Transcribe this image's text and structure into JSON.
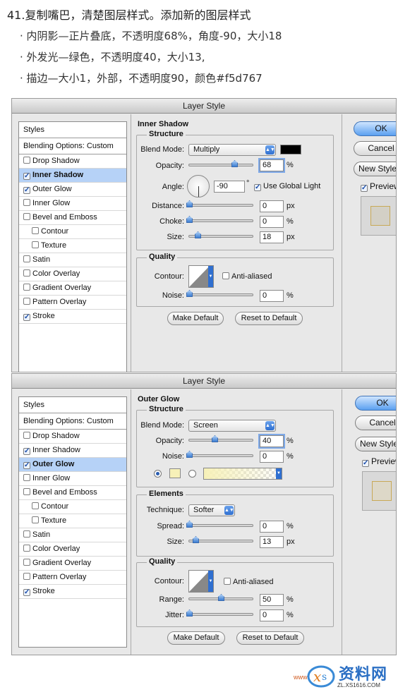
{
  "instructions": {
    "step": "41.复制嘴巴，清楚图层样式。添加新的图层样式",
    "b1": "· 内阴影—正片叠底，不透明度68%，角度-90，大小18",
    "b2": "· 外发光—绿色，不透明度40，大小13,",
    "b3": "· 描边—大小1，外部，不透明度90，颜色#f5d767"
  },
  "dialog1": {
    "title": "Layer Style",
    "styles": [
      {
        "label": "Styles",
        "checkbox": false
      },
      {
        "label": "Blending Options: Custom",
        "checkbox": false
      },
      {
        "label": "Drop Shadow",
        "checkbox": true,
        "checked": false
      },
      {
        "label": "Inner Shadow",
        "checkbox": true,
        "checked": true,
        "selected": true
      },
      {
        "label": "Outer Glow",
        "checkbox": true,
        "checked": true
      },
      {
        "label": "Inner Glow",
        "checkbox": true,
        "checked": false
      },
      {
        "label": "Bevel and Emboss",
        "checkbox": true,
        "checked": false
      },
      {
        "label": "Contour",
        "checkbox": true,
        "checked": false,
        "indent": true
      },
      {
        "label": "Texture",
        "checkbox": true,
        "checked": false,
        "indent": true
      },
      {
        "label": "Satin",
        "checkbox": true,
        "checked": false
      },
      {
        "label": "Color Overlay",
        "checkbox": true,
        "checked": false
      },
      {
        "label": "Gradient Overlay",
        "checkbox": true,
        "checked": false
      },
      {
        "label": "Pattern Overlay",
        "checkbox": true,
        "checked": false
      },
      {
        "label": "Stroke",
        "checkbox": true,
        "checked": true
      }
    ],
    "section": "Inner Shadow",
    "structure": "Structure",
    "blend_mode_label": "Blend Mode:",
    "blend_mode": "Multiply",
    "blend_color": "#000000",
    "opacity_label": "Opacity:",
    "opacity": "68",
    "angle_label": "Angle:",
    "angle": "-90",
    "global_light": "Use Global Light",
    "distance_label": "Distance:",
    "distance": "0",
    "choke_label": "Choke:",
    "choke": "0",
    "size_label": "Size:",
    "size": "18",
    "quality": "Quality",
    "contour_label": "Contour:",
    "anti_aliased": "Anti-aliased",
    "noise_label": "Noise:",
    "noise": "0",
    "make_default": "Make Default",
    "reset_default": "Reset to Default",
    "ok": "OK",
    "cancel": "Cancel",
    "new_style": "New Style...",
    "preview": "Preview",
    "unit_pct": "%",
    "unit_px": "px",
    "deg": "°"
  },
  "dialog2": {
    "title": "Layer Style",
    "styles": [
      {
        "label": "Styles",
        "checkbox": false
      },
      {
        "label": "Blending Options: Custom",
        "checkbox": false
      },
      {
        "label": "Drop Shadow",
        "checkbox": true,
        "checked": false
      },
      {
        "label": "Inner Shadow",
        "checkbox": true,
        "checked": true
      },
      {
        "label": "Outer Glow",
        "checkbox": true,
        "checked": true,
        "selected": true
      },
      {
        "label": "Inner Glow",
        "checkbox": true,
        "checked": false
      },
      {
        "label": "Bevel and Emboss",
        "checkbox": true,
        "checked": false
      },
      {
        "label": "Contour",
        "checkbox": true,
        "checked": false,
        "indent": true
      },
      {
        "label": "Texture",
        "checkbox": true,
        "checked": false,
        "indent": true
      },
      {
        "label": "Satin",
        "checkbox": true,
        "checked": false
      },
      {
        "label": "Color Overlay",
        "checkbox": true,
        "checked": false
      },
      {
        "label": "Gradient Overlay",
        "checkbox": true,
        "checked": false
      },
      {
        "label": "Pattern Overlay",
        "checkbox": true,
        "checked": false
      },
      {
        "label": "Stroke",
        "checkbox": true,
        "checked": true
      }
    ],
    "section": "Outer Glow",
    "structure": "Structure",
    "blend_mode_label": "Blend Mode:",
    "blend_mode": "Screen",
    "opacity_label": "Opacity:",
    "opacity": "40",
    "noise_label": "Noise:",
    "noise": "0",
    "glow_color": "#f7f1b8",
    "elements": "Elements",
    "technique_label": "Technique:",
    "technique": "Softer",
    "spread_label": "Spread:",
    "spread": "0",
    "size_label": "Size:",
    "size": "13",
    "quality": "Quality",
    "contour_label": "Contour:",
    "anti_aliased": "Anti-aliased",
    "range_label": "Range:",
    "range": "50",
    "jitter_label": "Jitter:",
    "jitter": "0",
    "make_default": "Make Default",
    "reset_default": "Reset to Default",
    "ok": "OK",
    "cancel": "Cancel",
    "new_style": "New Style...",
    "preview": "Preview",
    "unit_pct": "%",
    "unit_px": "px"
  },
  "watermark": {
    "logo_text": "资料网",
    "url": "ZL.XS1616.COM",
    "prefix": "www"
  }
}
